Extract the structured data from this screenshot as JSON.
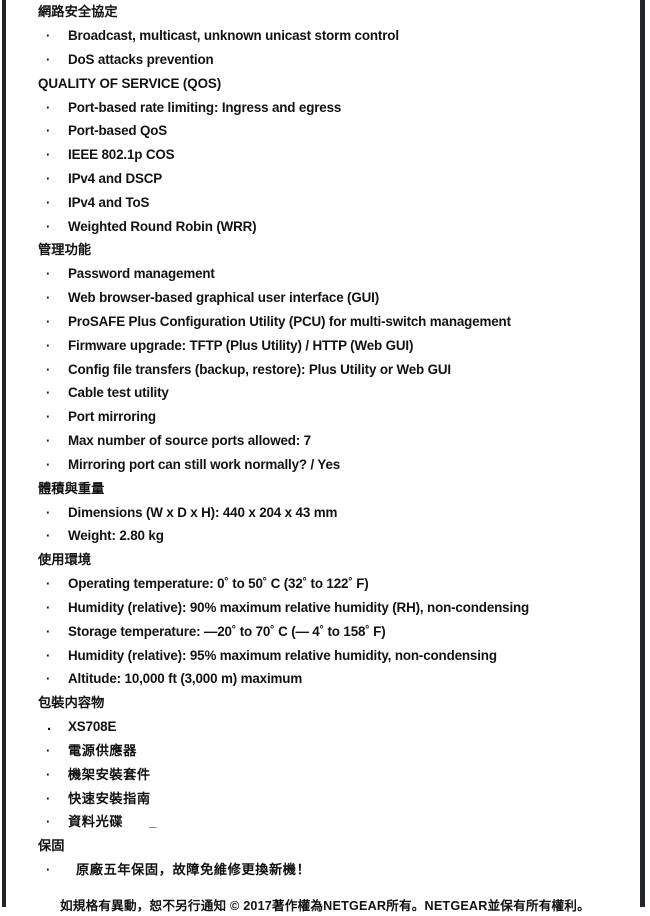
{
  "document": {
    "type": "product-specification-sheet",
    "language": "zh-Hant + en",
    "bullet_glyph": "·",
    "period_glyph": ".",
    "trailing_mark": "_",
    "colors": {
      "page_background": "#ffffff",
      "text": "#121212",
      "edge_rule": "#22252a"
    }
  },
  "sections": [
    {
      "id": "network-security",
      "heading": "網路安全協定",
      "heading_script": "cjk",
      "items": [
        {
          "text": "Broadcast, multicast, unknown unicast storm control",
          "script": "latin"
        },
        {
          "text": "DoS attacks prevention",
          "script": "latin"
        }
      ]
    },
    {
      "id": "quality-of-service",
      "heading": "QUALITY OF SERVICE (QOS)",
      "heading_script": "latin",
      "items": [
        {
          "text": "Port-based rate limiting: Ingress and egress",
          "script": "latin"
        },
        {
          "text": "Port-based QoS",
          "script": "latin"
        },
        {
          "text": "IEEE 802.1p COS",
          "script": "latin"
        },
        {
          "text": "IPv4 and DSCP",
          "script": "latin"
        },
        {
          "text": "IPv4 and ToS",
          "script": "latin"
        },
        {
          "text": "Weighted Round Robin (WRR)",
          "script": "latin"
        }
      ]
    },
    {
      "id": "management",
      "heading": "管理功能",
      "heading_script": "cjk",
      "items": [
        {
          "text": "Password management",
          "script": "latin"
        },
        {
          "text": "Web browser-based graphical user interface (GUI)",
          "script": "latin"
        },
        {
          "text": "ProSAFE Plus Configuration Utility (PCU) for multi-switch management",
          "script": "latin"
        },
        {
          "text": "Firmware upgrade: TFTP (Plus Utility) / HTTP (Web GUI)",
          "script": "latin"
        },
        {
          "text": "Config file transfers (backup, restore): Plus Utility or Web GUI",
          "script": "latin"
        },
        {
          "text": "Cable test utility",
          "script": "latin"
        },
        {
          "text": "Port mirroring",
          "script": "latin"
        },
        {
          "text": "Max number of source ports allowed: 7",
          "script": "latin"
        },
        {
          "text": "Mirroring port can still work normally? / Yes",
          "script": "latin"
        }
      ]
    },
    {
      "id": "dimensions-weight",
      "heading": "體積與重量",
      "heading_script": "cjk",
      "items": [
        {
          "text": "Dimensions (W x D x H): 440 x 204 x 43 mm",
          "script": "latin"
        },
        {
          "text": "Weight: 2.80 kg",
          "script": "latin"
        }
      ]
    },
    {
      "id": "operating-environment",
      "heading": "使用環境",
      "heading_script": "cjk",
      "items": [
        {
          "text": "Operating temperature: 0˚  to 50˚  C (32˚  to 122˚  F)",
          "script": "latin"
        },
        {
          "text": "Humidity (relative): 90% maximum relative humidity (RH), non-condensing",
          "script": "latin"
        },
        {
          "text": "Storage temperature: —20˚  to 70˚  C (— 4˚  to 158˚  F)",
          "script": "latin"
        },
        {
          "text": "Humidity (relative): 95% maximum relative humidity, non-condensing",
          "script": "latin"
        },
        {
          "text": "Altitude: 10,000 ft (3,000 m) maximum",
          "script": "latin"
        }
      ]
    },
    {
      "id": "package-contents",
      "heading": "包裝内容物",
      "heading_script": "cjk",
      "items": [
        {
          "text": "XS708E",
          "script": "latin",
          "marker": "period"
        },
        {
          "text": "電源供應器",
          "script": "cjk"
        },
        {
          "text": "機架安裝套件",
          "script": "cjk"
        },
        {
          "text": "快速安裝指南",
          "script": "cjk"
        },
        {
          "text": "資料光碟",
          "script": "cjk",
          "trailing_mark": "_"
        }
      ]
    },
    {
      "id": "warranty",
      "heading": "保固",
      "heading_script": "cjk",
      "items": [
        {
          "text": "原廠五年保固，故障免維修更換新機！",
          "script": "cjk",
          "indent": "extra"
        }
      ]
    }
  ],
  "footer": {
    "note": "如規格有異動，恕不另行通知 © 2017著作權為NETGEAR所有。NETGEAR並保有所有權利。"
  }
}
